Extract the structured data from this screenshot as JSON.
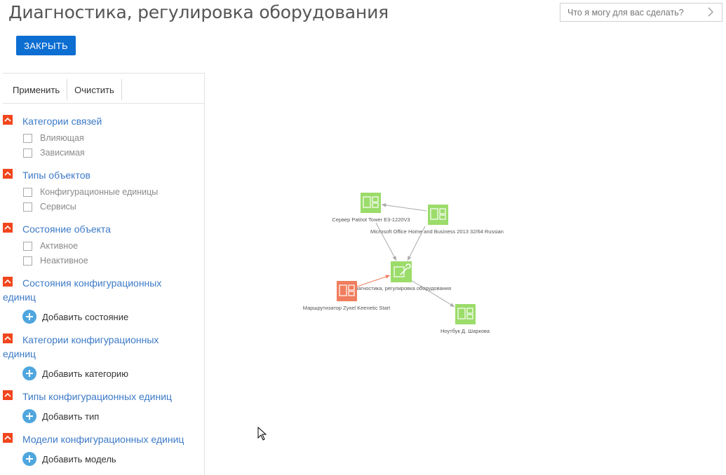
{
  "header": {
    "title": "Диагностика, регулировка оборудования",
    "help_placeholder": "Что я могу для вас сделать?",
    "close_label": "ЗАКРЫТЬ"
  },
  "filter": {
    "apply_label": "Применить",
    "clear_label": "Очистить",
    "sections": {
      "link_categories": {
        "title": "Категории связей",
        "options": [
          "Влияющая",
          "Зависимая"
        ]
      },
      "object_types": {
        "title": "Типы объектов",
        "options": [
          "Конфигурационные единицы",
          "Сервисы"
        ]
      },
      "object_state": {
        "title": "Состояние объекта",
        "options": [
          "Активное",
          "Неактивное"
        ]
      },
      "ci_states": {
        "title_line1": "Состояния конфигурационных",
        "title_line2": "единиц",
        "add_label": "Добавить состояние"
      },
      "ci_categories": {
        "title_line1": "Категории конфигурационных",
        "title_line2": "единиц",
        "add_label": "Добавить категорию"
      },
      "ci_types": {
        "title": "Типы конфигурационных единиц",
        "add_label": "Добавить тип"
      },
      "ci_models": {
        "title": "Модели конфигурационных единиц",
        "add_label": "Добавить модель"
      }
    }
  },
  "graph": {
    "nodes": {
      "server": {
        "label": "Сервер Patriot Tower E3-1220V3",
        "color": "#9bdc6a"
      },
      "office": {
        "label": "Microsoft Office Home and Business 2013 32/64 Russian",
        "color": "#9bdc6a"
      },
      "center": {
        "label": "Диагностика, регулировка оборудования",
        "color": "#9bdc6a"
      },
      "router": {
        "label": "Маршрутизатор Zyxel Keenetic Start",
        "color": "#f07d5d"
      },
      "laptop": {
        "label": "Ноутбук Д. Шаркова",
        "color": "#9bdc6a"
      }
    },
    "edge_color": "#aaaaaa",
    "highlight_edge_color": "#f07d5d"
  }
}
